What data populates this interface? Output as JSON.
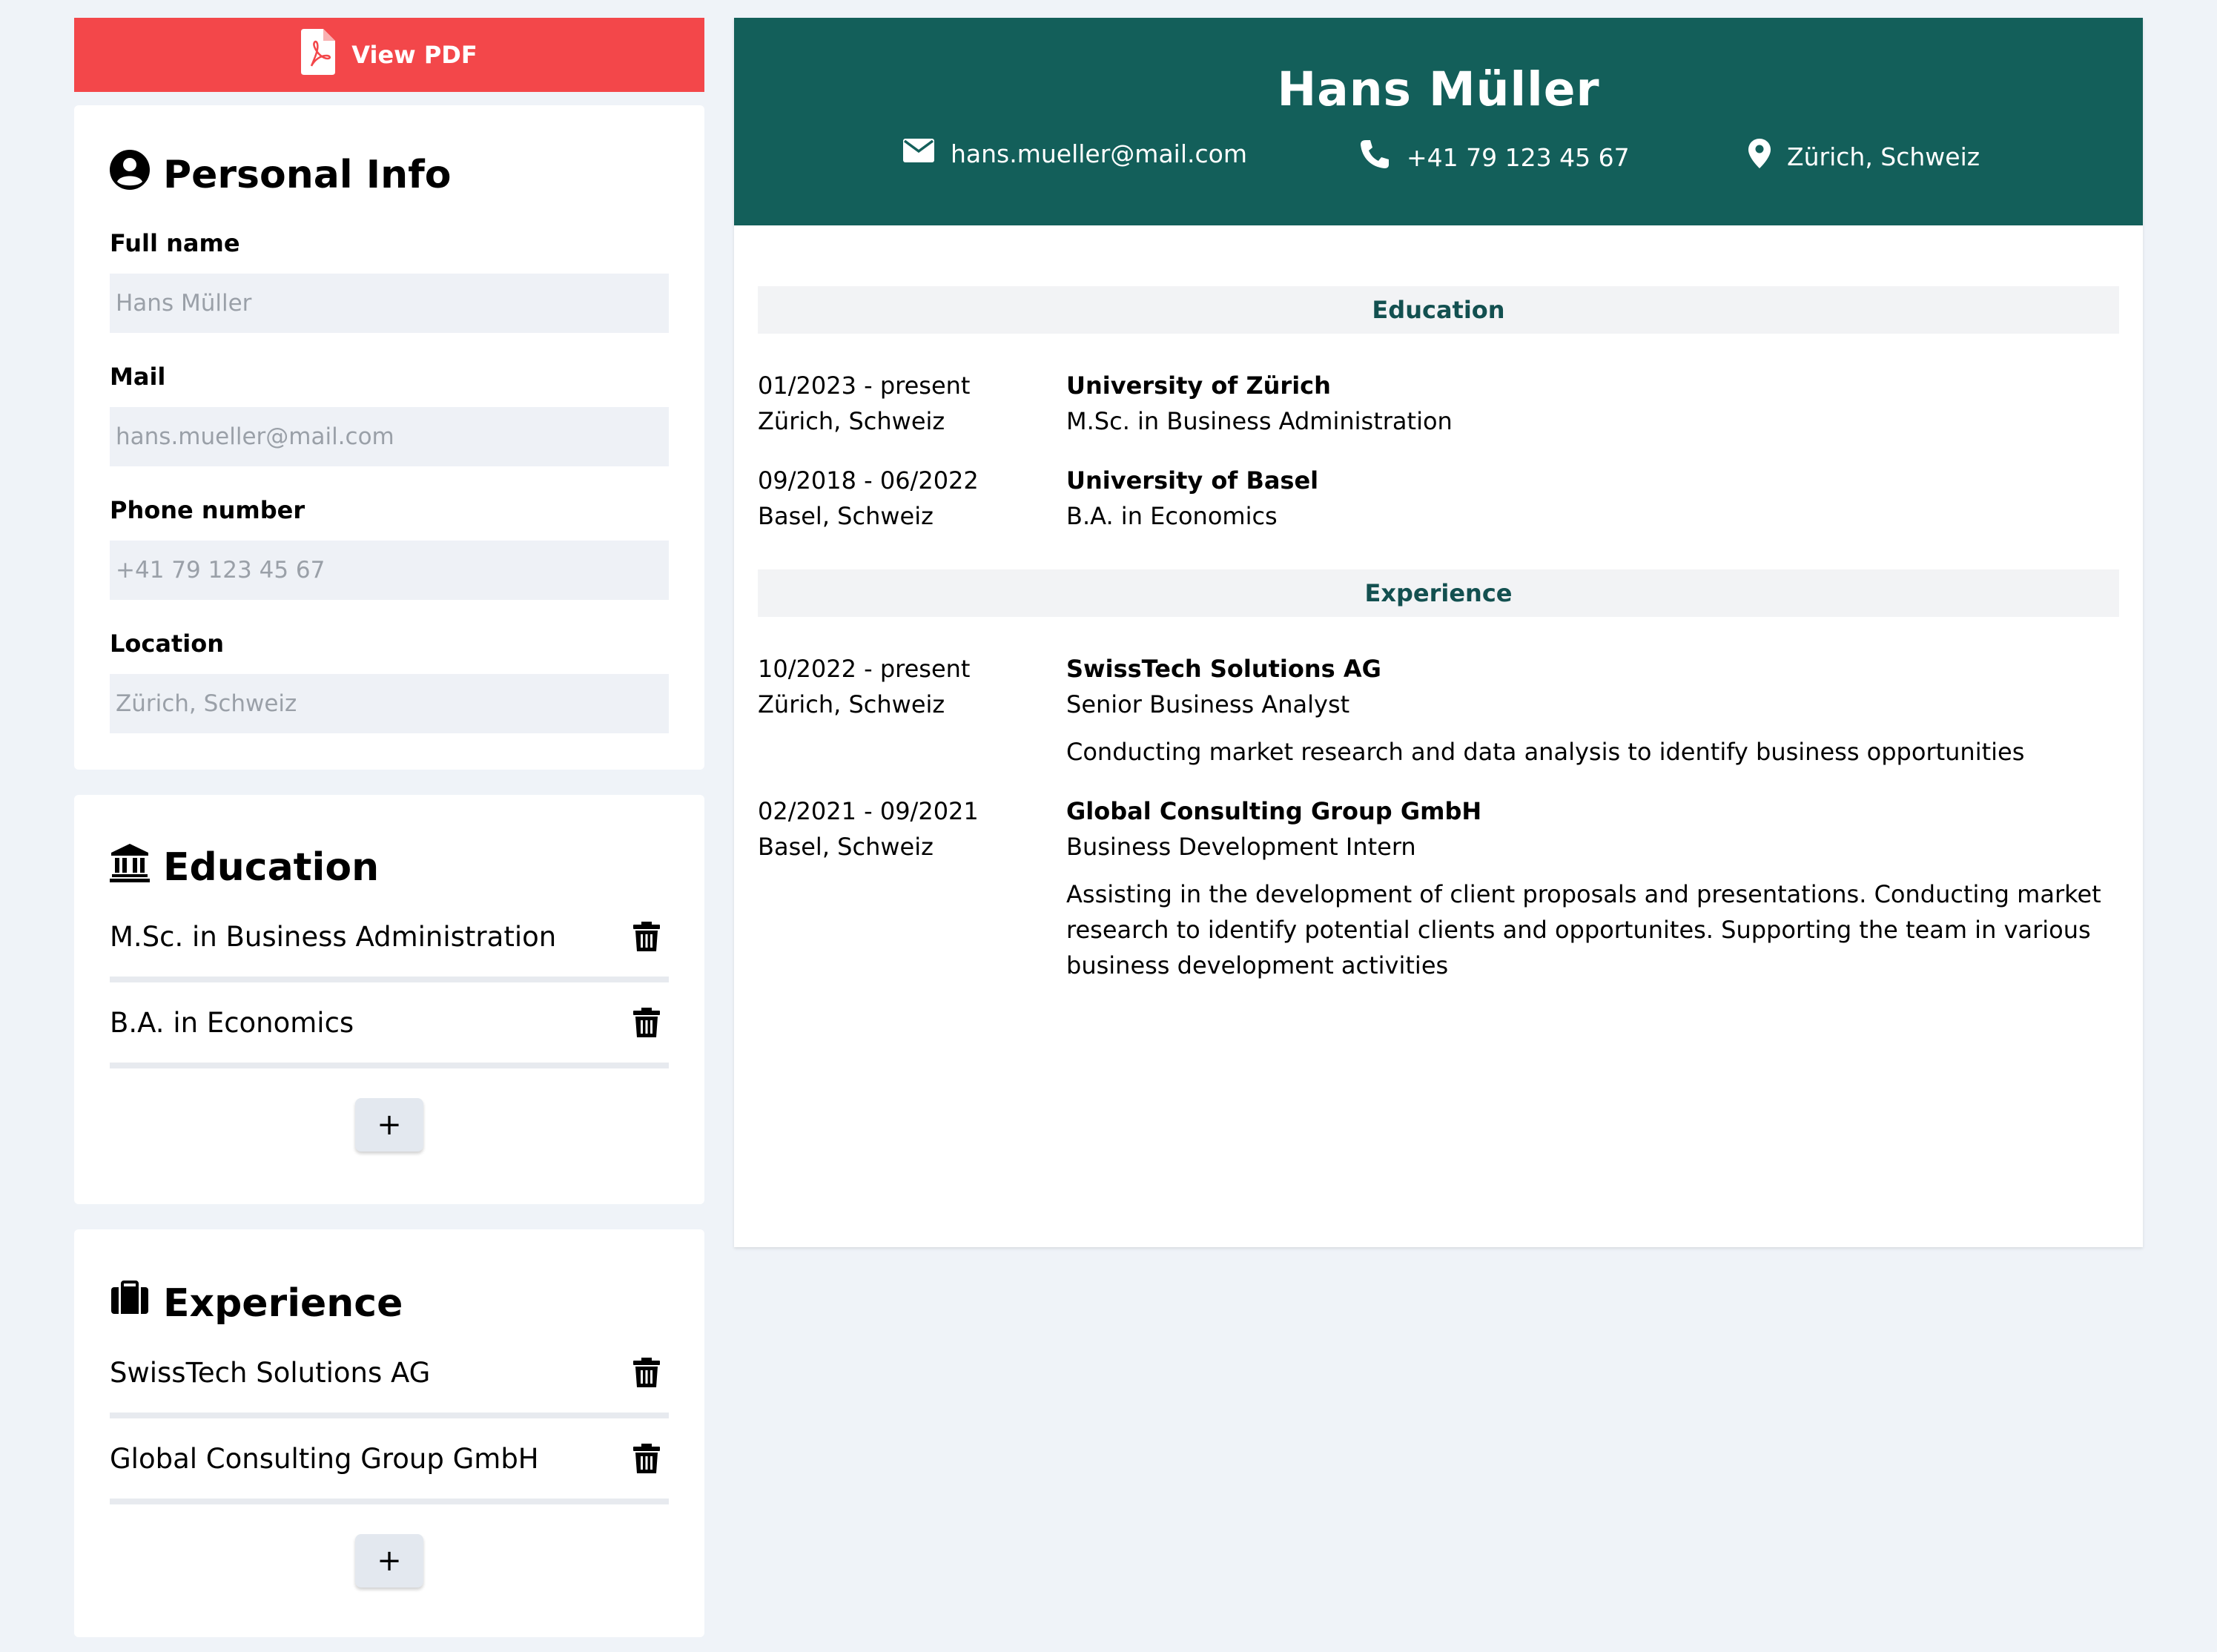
{
  "toolbar": {
    "view_pdf_label": "View PDF"
  },
  "personal_info": {
    "title": "Personal Info",
    "fields": {
      "full_name": {
        "label": "Full name",
        "placeholder": "Hans Müller"
      },
      "mail": {
        "label": "Mail",
        "placeholder": "hans.mueller@mail.com"
      },
      "phone": {
        "label": "Phone number",
        "placeholder": "+41 79 123 45 67"
      },
      "location": {
        "label": "Location",
        "placeholder": "Zürich, Schweiz"
      }
    }
  },
  "education_editor": {
    "title": "Education",
    "items": [
      {
        "label": "M.Sc. in Business Administration"
      },
      {
        "label": "B.A. in Economics"
      }
    ],
    "add_label": "+"
  },
  "experience_editor": {
    "title": "Experience",
    "items": [
      {
        "label": "SwissTech Solutions AG"
      },
      {
        "label": "Global Consulting Group GmbH"
      }
    ],
    "add_label": "+"
  },
  "cv": {
    "name": "Hans Müller",
    "email": "hans.mueller@mail.com",
    "phone": "+41 79 123 45 67",
    "location": "Zürich, Schweiz",
    "education_title": "Education",
    "education": [
      {
        "dates": "01/2023 - present",
        "place": "Zürich, Schweiz",
        "institution": "University of Zürich",
        "degree": "M.Sc. in Business Administration"
      },
      {
        "dates": "09/2018 - 06/2022",
        "place": "Basel, Schweiz",
        "institution": "University of Basel",
        "degree": "B.A. in Economics"
      }
    ],
    "experience_title": "Experience",
    "experience": [
      {
        "dates": "10/2022 - present",
        "place": "Zürich, Schweiz",
        "company": "SwissTech Solutions AG",
        "role": "Senior Business Analyst",
        "description": "Conducting market research and data analysis to identify business opportunities"
      },
      {
        "dates": "02/2021 - 09/2021",
        "place": "Basel, Schweiz",
        "company": "Global Consulting Group GmbH",
        "role": "Business Development Intern",
        "description": "Assisting in the development of client proposals and presentations. Conducting market research to identify potential clients and opportunites. Supporting the team in various business development activities"
      }
    ]
  },
  "colors": {
    "accent_red": "#f3474a",
    "header_green": "#135f5a",
    "section_text": "#135050",
    "page_bg": "#eff3f8"
  },
  "icons": [
    "pdf-file-icon",
    "user-circle-icon",
    "institution-icon",
    "briefcase-icon",
    "trash-icon",
    "mail-icon",
    "phone-icon",
    "location-pin-icon"
  ]
}
